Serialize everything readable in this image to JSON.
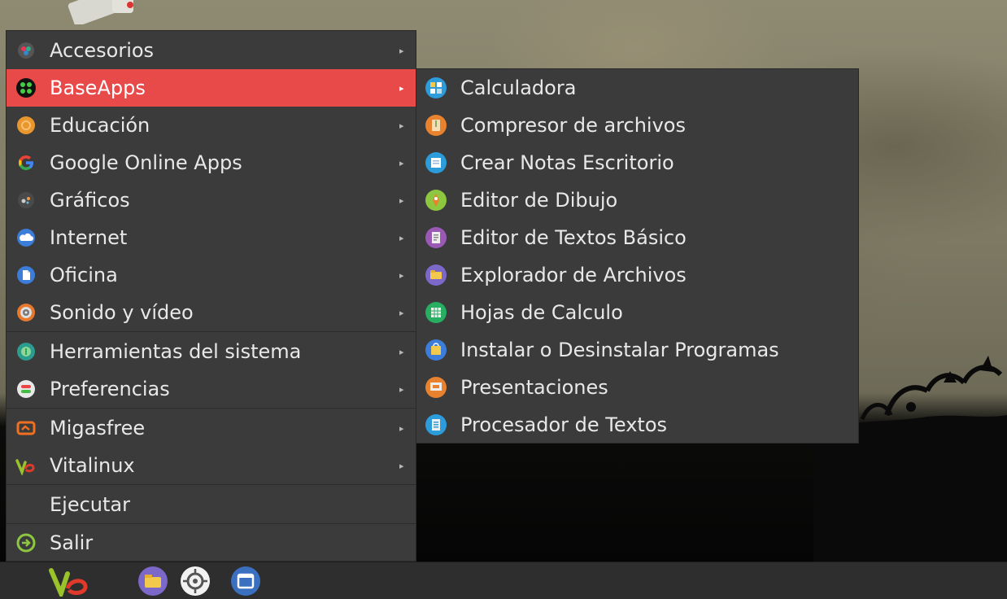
{
  "main_menu": {
    "items": [
      {
        "label": "Accesorios",
        "icon": "accessories-icon"
      },
      {
        "label": "BaseApps",
        "icon": "baseapps-icon"
      },
      {
        "label": "Educación",
        "icon": "education-icon"
      },
      {
        "label": "Google Online Apps",
        "icon": "google-icon"
      },
      {
        "label": "Gráficos",
        "icon": "graphics-icon"
      },
      {
        "label": "Internet",
        "icon": "internet-cloud-icon"
      },
      {
        "label": "Oficina",
        "icon": "office-document-icon"
      },
      {
        "label": "Sonido y vídeo",
        "icon": "sound-video-icon"
      },
      {
        "label": "Herramientas del sistema",
        "icon": "system-tools-icon"
      },
      {
        "label": "Preferencias",
        "icon": "preferences-icon"
      },
      {
        "label": "Migasfree",
        "icon": "migasfree-icon"
      },
      {
        "label": "Vitalinux",
        "icon": "vitalinux-icon"
      },
      {
        "label": "Ejecutar",
        "icon": ""
      },
      {
        "label": "Salir",
        "icon": "logout-icon"
      }
    ],
    "active_item": "BaseApps",
    "submenu_arrow": "▸"
  },
  "submenu": {
    "items": [
      {
        "label": "Calculadora",
        "icon": "calculator-icon"
      },
      {
        "label": "Compresor de archivos",
        "icon": "archive-icon"
      },
      {
        "label": "Crear Notas Escritorio",
        "icon": "notes-icon"
      },
      {
        "label": "Editor de Dibujo",
        "icon": "drawing-icon"
      },
      {
        "label": "Editor de Textos Básico",
        "icon": "text-editor-icon"
      },
      {
        "label": "Explorador de Archivos",
        "icon": "file-manager-icon"
      },
      {
        "label": "Hojas de Calculo",
        "icon": "spreadsheet-icon"
      },
      {
        "label": "Instalar o Desinstalar Programas",
        "icon": "software-center-icon"
      },
      {
        "label": "Presentaciones",
        "icon": "presentation-icon"
      },
      {
        "label": "Procesador de Textos",
        "icon": "word-processor-icon"
      }
    ]
  },
  "panel": {
    "launchers": [
      "vitalinux-menu-icon",
      "files-icon",
      "settings-target-icon",
      "window-icon"
    ]
  },
  "colors": {
    "menu_bg": "#3b3b3b",
    "active_bg": "#e84a4a",
    "text": "#e8e8e8",
    "panel_bg": "#2e2e2e"
  }
}
